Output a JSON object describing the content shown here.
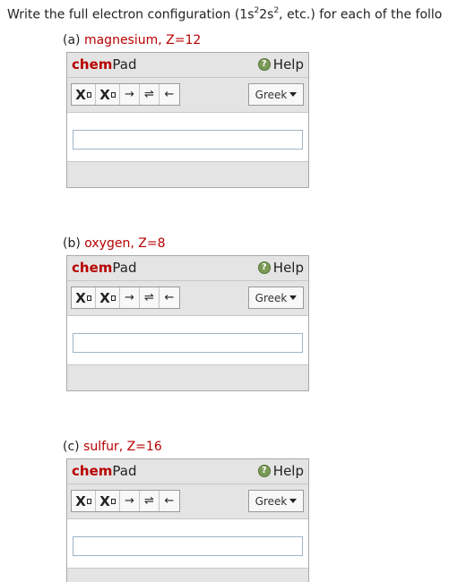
{
  "question": {
    "text_before": "Write the full electron configuration (1s",
    "sup1": "2",
    "text_mid": "2s",
    "sup2": "2",
    "text_after": ", etc.) for each of the follo"
  },
  "parts": [
    {
      "letter": "(a)",
      "element": "magnesium, Z=12"
    },
    {
      "letter": "(b)",
      "element": "oxygen, Z=8"
    },
    {
      "letter": "(c)",
      "element": "sulfur, Z=16"
    }
  ],
  "chempad": {
    "brand": "chem",
    "pad": "Pad",
    "help_label": "Help",
    "help_icon": "?",
    "subscript_letter": "X",
    "superscript_letter": "X",
    "arrow_right": "→",
    "arrow_equilibrium": "⇌",
    "arrow_left": "←",
    "greek_label": "Greek",
    "input_value": ""
  },
  "colors": {
    "accent_red": "#b80000",
    "help_green": "#7a9a55",
    "panel_gray": "#e4e4e4"
  }
}
